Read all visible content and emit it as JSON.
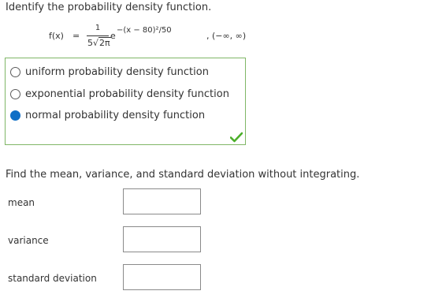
{
  "question1": {
    "prompt": "Identify the probability density function.",
    "formula": {
      "lhs": "f(x)",
      "equals": "=",
      "numerator": "1",
      "den_coef": "5",
      "den_radical": "√",
      "den_radicand": "2π",
      "base": "e",
      "exponent": "−(x − 80)²/50",
      "domain": ",  (−∞, ∞)"
    },
    "options": [
      {
        "label": "uniform probability density function",
        "selected": false
      },
      {
        "label": "exponential probability density function",
        "selected": false
      },
      {
        "label": "normal probability density function",
        "selected": true
      }
    ],
    "status_icon": "green-checkmark-icon",
    "border_color": "#80b666",
    "check_color": "#4caf2a"
  },
  "question2": {
    "prompt": "Find the mean, variance, and standard deviation without integrating.",
    "fields": [
      {
        "label": "mean",
        "value": ""
      },
      {
        "label": "variance",
        "value": ""
      },
      {
        "label": "standard deviation",
        "value": ""
      }
    ]
  },
  "colors": {
    "accent": "#0f6fc6",
    "text": "#333333"
  }
}
